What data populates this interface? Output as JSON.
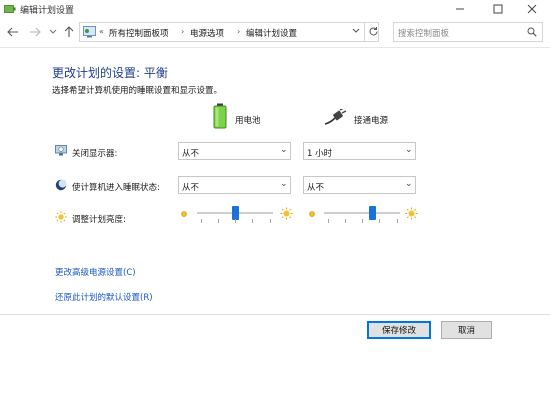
{
  "window": {
    "title": "编辑计划设置"
  },
  "address": {
    "prefix": "«",
    "crumbs": [
      "所有控制面板项",
      "电源选项",
      "编辑计划设置"
    ],
    "search_placeholder": "搜索控制面板"
  },
  "main": {
    "heading": "更改计划的设置: 平衡",
    "subheading": "选择希望计算机使用的睡眠设置和显示设置。",
    "columns": {
      "battery": "用电池",
      "plugged": "接通电源"
    },
    "rows": {
      "display": {
        "label": "关闭显示器:",
        "battery_value": "从不",
        "plugged_value": "1 小时"
      },
      "sleep": {
        "label": "使计算机进入睡眠状态:",
        "battery_value": "从不",
        "plugged_value": "从不"
      },
      "brightness": {
        "label": "调整计划亮度:",
        "battery_level_percent": 50,
        "plugged_level_percent": 65
      }
    },
    "links": {
      "advanced": "更改高级电源设置(C)",
      "restore": "还原此计划的默认设置(R)"
    }
  },
  "buttons": {
    "save": "保存修改",
    "cancel": "取消"
  },
  "icons": {
    "app": "power-options-icon",
    "minimize": "minimize-icon",
    "maximize": "maximize-icon",
    "close": "close-icon",
    "back": "back-arrow-icon",
    "forward": "forward-arrow-icon",
    "recent": "chevron-down-icon",
    "up": "up-arrow-icon",
    "refresh": "refresh-icon",
    "search": "search-icon",
    "battery": "battery-icon",
    "plug": "power-plug-icon",
    "display": "display-icon",
    "sleep": "sleep-icon",
    "brightness": "brightness-icon"
  },
  "colors": {
    "heading": "#1f3e8a",
    "link": "#1a56c9",
    "accent": "#0078d7",
    "slider_thumb": "#1a73d9"
  }
}
